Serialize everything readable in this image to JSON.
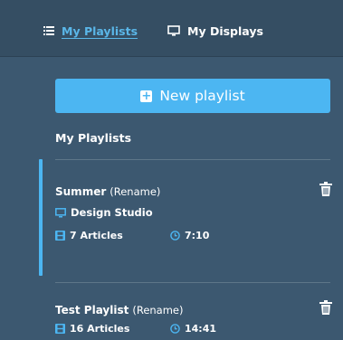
{
  "colors": {
    "background": "#3c5870",
    "topbar": "#354e63",
    "accent": "#4cb6f2",
    "active_tab": "#5ab6e8"
  },
  "nav": {
    "tabs": [
      {
        "label": "My Playlists",
        "icon": "list-icon",
        "active": true
      },
      {
        "label": "My Displays",
        "icon": "monitor-icon",
        "active": false
      }
    ]
  },
  "new_playlist_button": {
    "label": "New playlist",
    "icon": "plus-square-icon"
  },
  "section_title": "My Playlists",
  "playlists": [
    {
      "name": "Summer",
      "rename_label": "(Rename)",
      "display": "Design Studio",
      "articles": "7 Articles",
      "duration": "7:10",
      "selected": true
    },
    {
      "name": "Test Playlist",
      "rename_label": "(Rename)",
      "articles": "16 Articles",
      "duration": "14:41",
      "selected": false
    }
  ]
}
